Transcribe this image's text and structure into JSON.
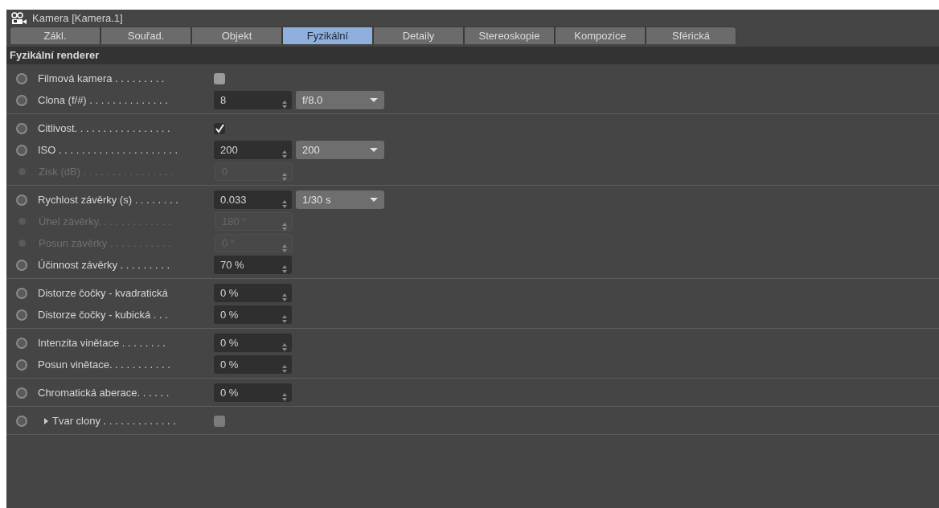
{
  "window": {
    "title": "Kamera [Kamera.1]"
  },
  "tabs": [
    {
      "label": "Zákl.",
      "selected": false
    },
    {
      "label": "Souřad.",
      "selected": false
    },
    {
      "label": "Objekt",
      "selected": false
    },
    {
      "label": "Fyzikální",
      "selected": true
    },
    {
      "label": "Detaily",
      "selected": false
    },
    {
      "label": "Stereoskopie",
      "selected": false
    },
    {
      "label": "Kompozice",
      "selected": false
    },
    {
      "label": "Sférická",
      "selected": false
    }
  ],
  "section": {
    "title": "Fyzikální renderer"
  },
  "groups": [
    [
      {
        "kind": "checkbox",
        "label": "Filmová kamera . . . . . . . . .",
        "disabled": false,
        "checked": false
      },
      {
        "kind": "number",
        "label": "Clona (f/#) . . . . . . . . . . . . . .",
        "disabled": false,
        "value": "8",
        "dropdown": "f/8.0"
      }
    ],
    [
      {
        "kind": "checkbox",
        "label": "Citlivost. . . . . . . . . . . . . . . . .",
        "disabled": false,
        "checked": true
      },
      {
        "kind": "number",
        "label": "ISO . . . . . . . . . . . . . . . . . . . . .",
        "disabled": false,
        "value": "200",
        "dropdown": "200"
      },
      {
        "kind": "number",
        "label": "Zisk (dB) . . . . . . . . . . . . . . . .",
        "disabled": true,
        "value": "0"
      }
    ],
    [
      {
        "kind": "number",
        "label": "Rychlost závěrky (s) . . . . . . . .",
        "disabled": false,
        "value": "0.033",
        "dropdown": "1/30 s"
      },
      {
        "kind": "number",
        "label": "Úhel závěrky. . . . . . . . . . . . .",
        "disabled": true,
        "value": "180 °"
      },
      {
        "kind": "number",
        "label": "Posun závěrky . . . . . . . . . . .",
        "disabled": true,
        "value": "0 °"
      },
      {
        "kind": "number",
        "label": "Účinnost závěrky . . . . . . . . .",
        "disabled": false,
        "value": "70 %"
      }
    ],
    [
      {
        "kind": "number",
        "label": "Distorze čočky - kvadratická",
        "disabled": false,
        "value": "0 %"
      },
      {
        "kind": "number",
        "label": "Distorze čočky - kubická . . .",
        "disabled": false,
        "value": "0 %"
      }
    ],
    [
      {
        "kind": "number",
        "label": "Intenzita vinětace . . . . . . . .",
        "disabled": false,
        "value": "0 %"
      },
      {
        "kind": "number",
        "label": "Posun vinětace. . . . . . . . . . .",
        "disabled": false,
        "value": "0 %"
      }
    ],
    [
      {
        "kind": "number",
        "label": "Chromatická aberace. . . . . .",
        "disabled": false,
        "value": "0 %"
      }
    ],
    [
      {
        "kind": "expander",
        "label": "Tvar clony . . . . . . . . . . . . .",
        "disabled": false,
        "expanded": false,
        "checked": false
      }
    ]
  ]
}
